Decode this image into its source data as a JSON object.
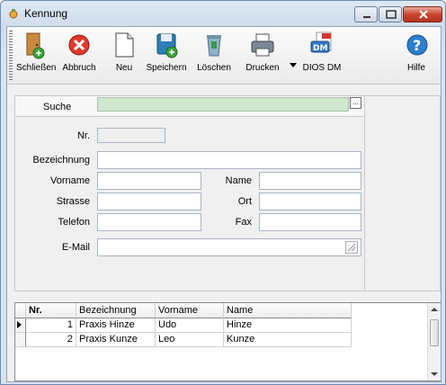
{
  "window": {
    "title": "Kennung"
  },
  "toolbar": {
    "items": [
      {
        "label": "Schließen"
      },
      {
        "label": "Abbruch"
      },
      {
        "label": "Neu"
      },
      {
        "label": "Speichern"
      },
      {
        "label": "Löschen"
      },
      {
        "label": "Drucken"
      },
      {
        "label": "DIOS DM"
      },
      {
        "label": "Hilfe"
      }
    ]
  },
  "search": {
    "label": "Suche",
    "value": "",
    "button": "..."
  },
  "form": {
    "nr": {
      "label": "Nr.",
      "value": ""
    },
    "bezeichnung": {
      "label": "Bezeichnung",
      "value": ""
    },
    "vorname": {
      "label": "Vorname",
      "value": ""
    },
    "name": {
      "label": "Name",
      "value": ""
    },
    "strasse": {
      "label": "Strasse",
      "value": ""
    },
    "ort": {
      "label": "Ort",
      "value": ""
    },
    "telefon": {
      "label": "Telefon",
      "value": ""
    },
    "fax": {
      "label": "Fax",
      "value": ""
    },
    "email": {
      "label": "E-Mail",
      "value": ""
    }
  },
  "grid": {
    "columns": [
      "Nr.",
      "Bezeichnung",
      "Vorname",
      "Name"
    ],
    "rows": [
      {
        "nr": "1",
        "bezeichnung": "Praxis Hinze",
        "vorname": "Udo",
        "name": "Hinze"
      },
      {
        "nr": "2",
        "bezeichnung": "Praxis Kunze",
        "vorname": "Leo",
        "name": "Kunze"
      }
    ]
  }
}
